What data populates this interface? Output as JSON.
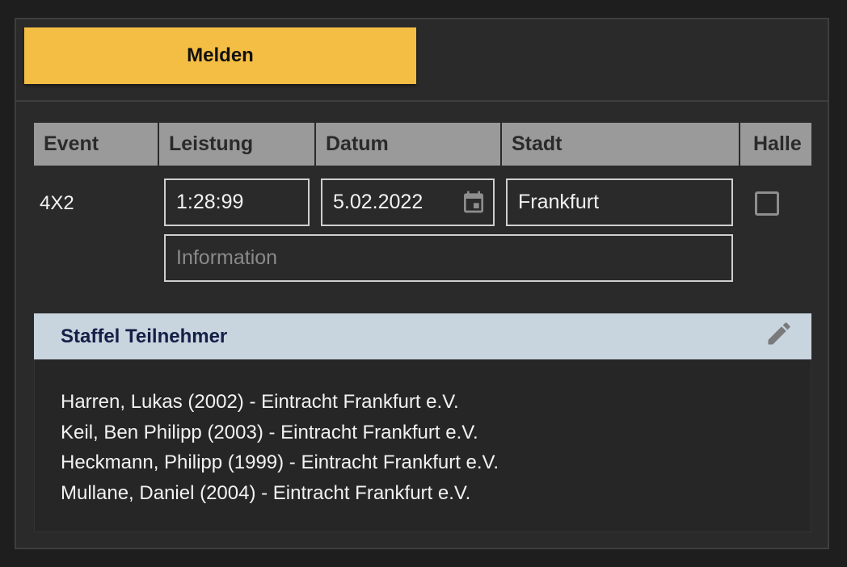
{
  "toolbar": {
    "melden_label": "Melden",
    "melden_color": "#f4be44"
  },
  "table": {
    "headers": [
      "Event",
      "Leistung",
      "Datum",
      "Stadt",
      "Halle"
    ],
    "row": {
      "event": "4X2",
      "leistung": "1:28:99",
      "datum": "5.02.2022",
      "stadt": "Frankfurt",
      "halle_checked": false,
      "information_placeholder": "Information",
      "information_value": ""
    }
  },
  "staffel": {
    "title": "Staffel Teilnehmer",
    "header_color": "#c8d4de",
    "members": [
      "Harren, Lukas (2002) - Eintracht Frankfurt e.V.",
      "Keil, Ben Philipp (2003) - Eintracht Frankfurt e.V.",
      "Heckmann, Philipp (1999) - Eintracht Frankfurt e.V.",
      "Mullane, Daniel (2004) - Eintracht Frankfurt e.V."
    ]
  },
  "icons": {
    "calendar": "calendar-icon",
    "edit": "pencil-icon"
  }
}
